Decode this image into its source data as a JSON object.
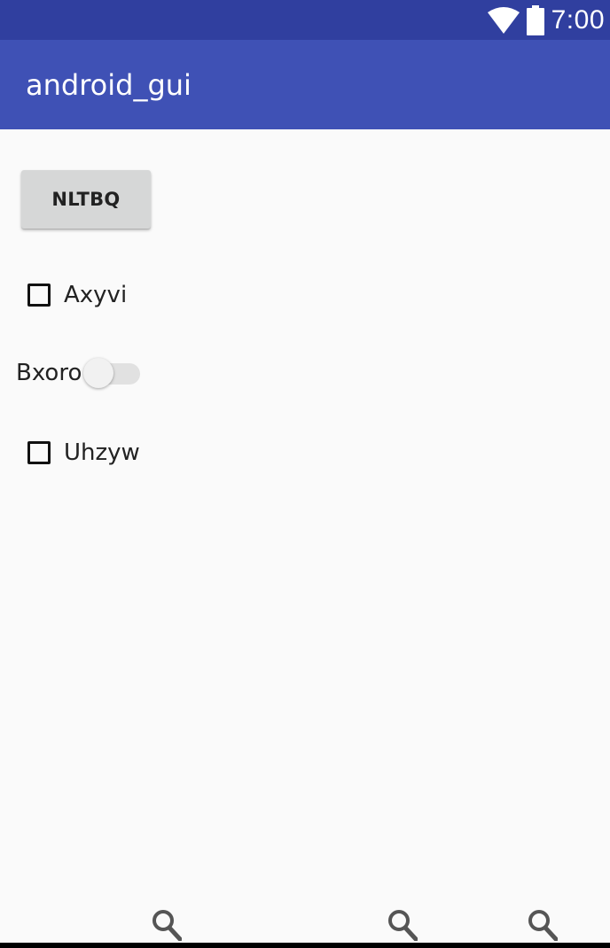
{
  "status_bar": {
    "time": "7:00",
    "icons": [
      "wifi-icon",
      "battery-icon"
    ],
    "background": "#303f9f"
  },
  "app_bar": {
    "title": "android_gui",
    "background": "#3f51b5"
  },
  "main": {
    "button_label": "NLTBQ",
    "checkbox_1": {
      "label": "Axyvi",
      "checked": false
    },
    "switch": {
      "label": "Bxoro",
      "on": false
    },
    "checkbox_2": {
      "label": "Uhzyw",
      "checked": false
    }
  },
  "bottom_icons": [
    "search-icon",
    "search-icon",
    "search-icon"
  ]
}
